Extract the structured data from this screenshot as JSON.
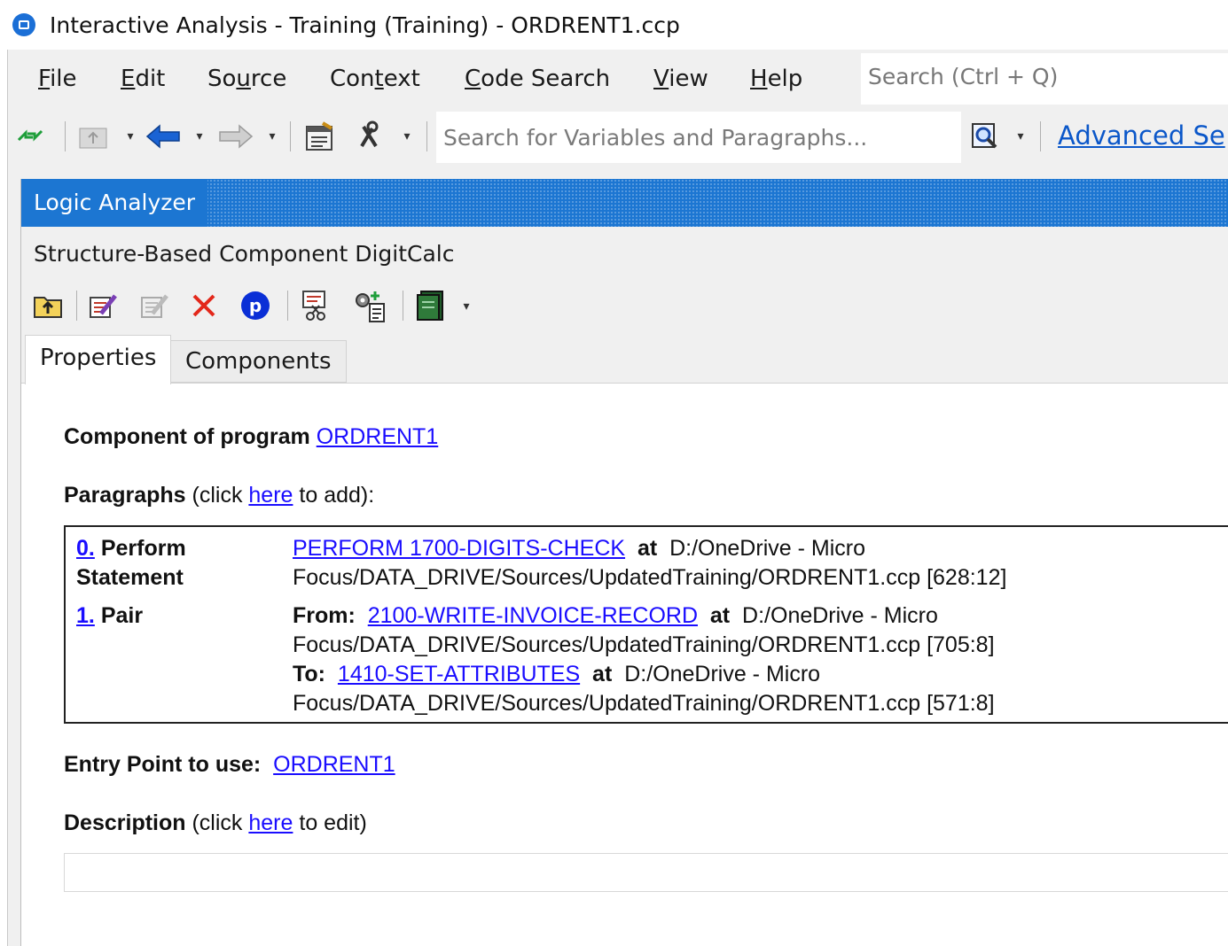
{
  "window": {
    "title": "Interactive Analysis - Training (Training) - ORDRENT1.ccp"
  },
  "menu": {
    "items": [
      {
        "pre": "",
        "ul": "F",
        "post": "ile"
      },
      {
        "pre": "",
        "ul": "E",
        "post": "dit"
      },
      {
        "pre": "So",
        "ul": "u",
        "post": "rce"
      },
      {
        "pre": "Con",
        "ul": "t",
        "post": "ext"
      },
      {
        "pre": "",
        "ul": "C",
        "post": "ode Search"
      },
      {
        "pre": "",
        "ul": "V",
        "post": "iew"
      },
      {
        "pre": "",
        "ul": "H",
        "post": "elp"
      }
    ],
    "search_placeholder": "Search (Ctrl + Q)"
  },
  "toolbar": {
    "search_placeholder": "Search for Variables and Paragraphs...",
    "advanced_link": "Advanced Se",
    "icons": [
      "sync-icon",
      "up-folder-icon",
      "back-arrow-icon",
      "forward-arrow-icon",
      "properties-icon",
      "tools-icon",
      "search-options-icon"
    ]
  },
  "logic_analyzer": {
    "header": "Logic Analyzer",
    "subtitle": "Structure-Based Component DigitCalc",
    "toolbar_icons": [
      "up-folder-icon",
      "edit-icon",
      "edit-disabled-icon",
      "delete-icon",
      "p-circle-icon",
      "scissors-icon",
      "gear-add-icon",
      "book-icon"
    ],
    "tabs": [
      "Properties",
      "Components"
    ],
    "active_tab": "Properties"
  },
  "properties": {
    "component_label": "Component of program",
    "component_link": "ORDRENT1",
    "paragraphs_label": "Paragraphs",
    "paragraphs_hint_pre": "(click ",
    "paragraphs_hint_link": "here",
    "paragraphs_hint_post": " to add):",
    "paragraphs": [
      {
        "index": "0.",
        "type_line1": "Perform",
        "type_line2": "Statement",
        "link": "PERFORM 1700-DIGITS-CHECK",
        "at": "at",
        "loc1": "D:/OneDrive - Micro",
        "loc2": "Focus/DATA_DRIVE/Sources/UpdatedTraining/ORDRENT1.ccp [628:12]"
      },
      {
        "index": "1.",
        "type_line1": "Pair",
        "from_label": "From:",
        "from_link": "2100-WRITE-INVOICE-RECORD",
        "from_at": "at",
        "from_loc1": "D:/OneDrive - Micro",
        "from_loc2": "Focus/DATA_DRIVE/Sources/UpdatedTraining/ORDRENT1.ccp [705:8]",
        "to_label": "To:",
        "to_link": "1410-SET-ATTRIBUTES",
        "to_at": "at",
        "to_loc1": "D:/OneDrive - Micro",
        "to_loc2": "Focus/DATA_DRIVE/Sources/UpdatedTraining/ORDRENT1.ccp [571:8]"
      }
    ],
    "entry_point_label": "Entry Point to use:",
    "entry_point_link": "ORDRENT1",
    "description_label": "Description",
    "description_hint_pre": "(click ",
    "description_hint_link": "here",
    "description_hint_post": " to edit)",
    "description_value": ""
  },
  "colors": {
    "panel_header": "#1c76d2",
    "link": "#1a0dff",
    "advanced_link": "#0b57c9"
  }
}
